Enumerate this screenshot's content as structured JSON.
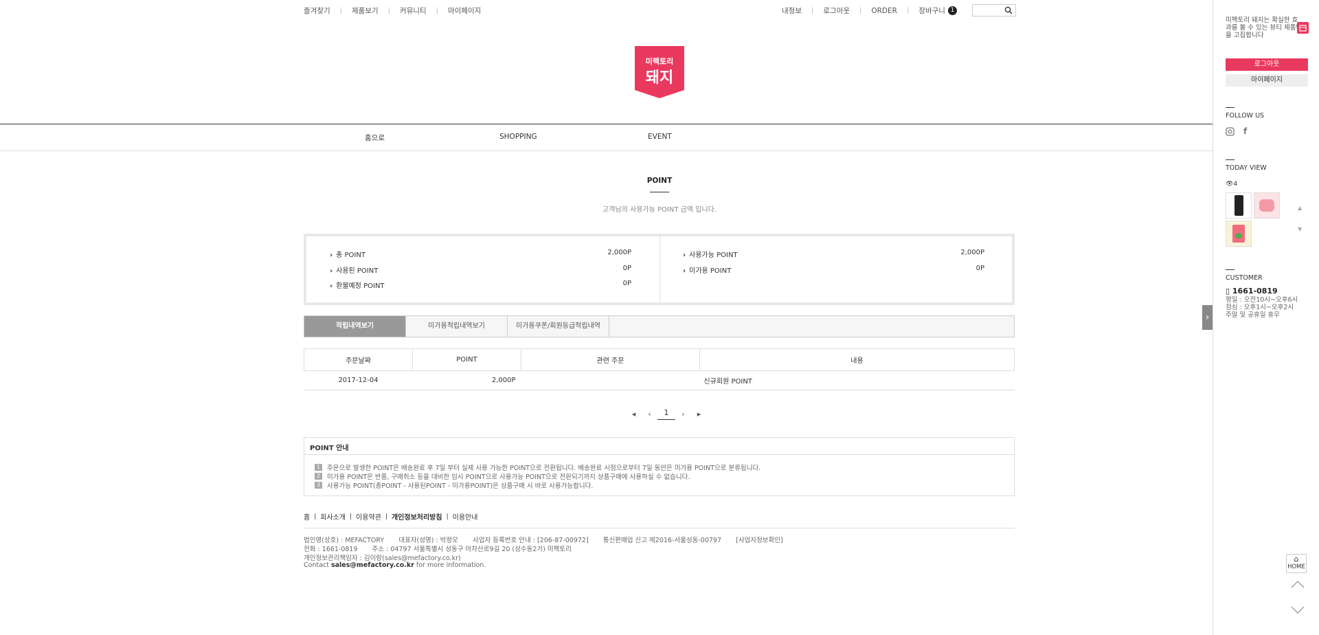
{
  "top": {
    "left_links": [
      "즐겨찾기",
      "제품보기",
      "커뮤니티",
      "마이페이지"
    ],
    "right_links": [
      "내정보",
      "로그아웃",
      "ORDER",
      "장바구니"
    ],
    "cart_count": "1"
  },
  "logo": {
    "line1": "미팩토리",
    "line2": "돼지"
  },
  "nav": [
    "홈으로",
    "SHOPPING",
    "EVENT"
  ],
  "page": {
    "title": "POINT",
    "subtitle": "고객님의 사용가능 POINT 금액 입니다."
  },
  "points": {
    "left": [
      {
        "label": "총 POINT",
        "value": "2,000P"
      },
      {
        "label": "사용된 POINT",
        "value": "0P"
      },
      {
        "label": "환불예정 POINT",
        "value": "0P"
      }
    ],
    "right": [
      {
        "label": "사용가능 POINT",
        "value": "2,000P"
      },
      {
        "label": "미가용 POINT",
        "value": "0P"
      }
    ]
  },
  "tabs": [
    "적립내역보기",
    "미가용적립내역보기",
    "미가용쿠폰/회원등급적립내역"
  ],
  "table": {
    "headers": [
      "주문날짜",
      "POINT",
      "관련 주문",
      "내용"
    ],
    "rows": [
      {
        "date": "2017-12-04",
        "point": "2,000P",
        "order": "",
        "content": "신규회원 POINT"
      }
    ]
  },
  "pager": {
    "current": "1"
  },
  "guide": {
    "title": "POINT 안내",
    "items": [
      {
        "num": "1",
        "text": "주문으로 발생한 POINT은 배송완료 후 7일 부터 실제 사용 가능한 POINT으로 전환됩니다. 배송완료 시점으로부터 7일 동안은 미가용 POINT으로 분류됩니다."
      },
      {
        "num": "2",
        "text": "미가용 POINT은 반품, 구매취소 등을 대비한 임시 POINT으로 사용가능 POINT으로 전환되기까지 상품구매에 사용하실 수 없습니다."
      },
      {
        "num": "3",
        "text": "사용가능 POINT(총POINT - 사용된POINT - 미가용POINT)은 상품구매 시 바로 사용가능합니다."
      }
    ]
  },
  "footer": {
    "links": [
      "홈",
      "회사소개",
      "이용약관",
      "개인정보처리방침",
      "이용안내"
    ],
    "line1": "법인명(상호) : MEFACTORY       대표자(성명) : 박정모       사업자 등록번호 안내 : [206-87-00972]       통신판매업 신고 제2016-서울성동-00797       [사업자정보확인]",
    "line2": "전화 : 1661-0819       주소 : 04797 서울특별시 성동구 아차산로9길 20 (성수동2가) 미팩토리",
    "line3": "개인정보관리책임자 : 김이랑(sales@mefactory.co.kr)",
    "contact_pre": "Contact ",
    "contact_email": "sales@mefactory.co.kr",
    "contact_post": " for more information."
  },
  "quick": {
    "intro": "미팩토리 돼지는 확실한 효과를 볼 수 있는 뷰티 제품만을 고집합니다",
    "logout": "로그아웃",
    "mypage": "마이페이지",
    "follow": "FOLLOW US",
    "today": "TODAY VIEW",
    "view_count": "4",
    "customer": "CUSTOMER",
    "phone": "1661-0819",
    "hours": [
      "평일 : 오전10시~오후6시",
      "점심 : 오후1시~오후2시",
      "주말 및 공휴일 휴무"
    ],
    "home": "HOME"
  },
  "colors": {
    "brand": "#e9395e",
    "tab_active": "#999999"
  }
}
